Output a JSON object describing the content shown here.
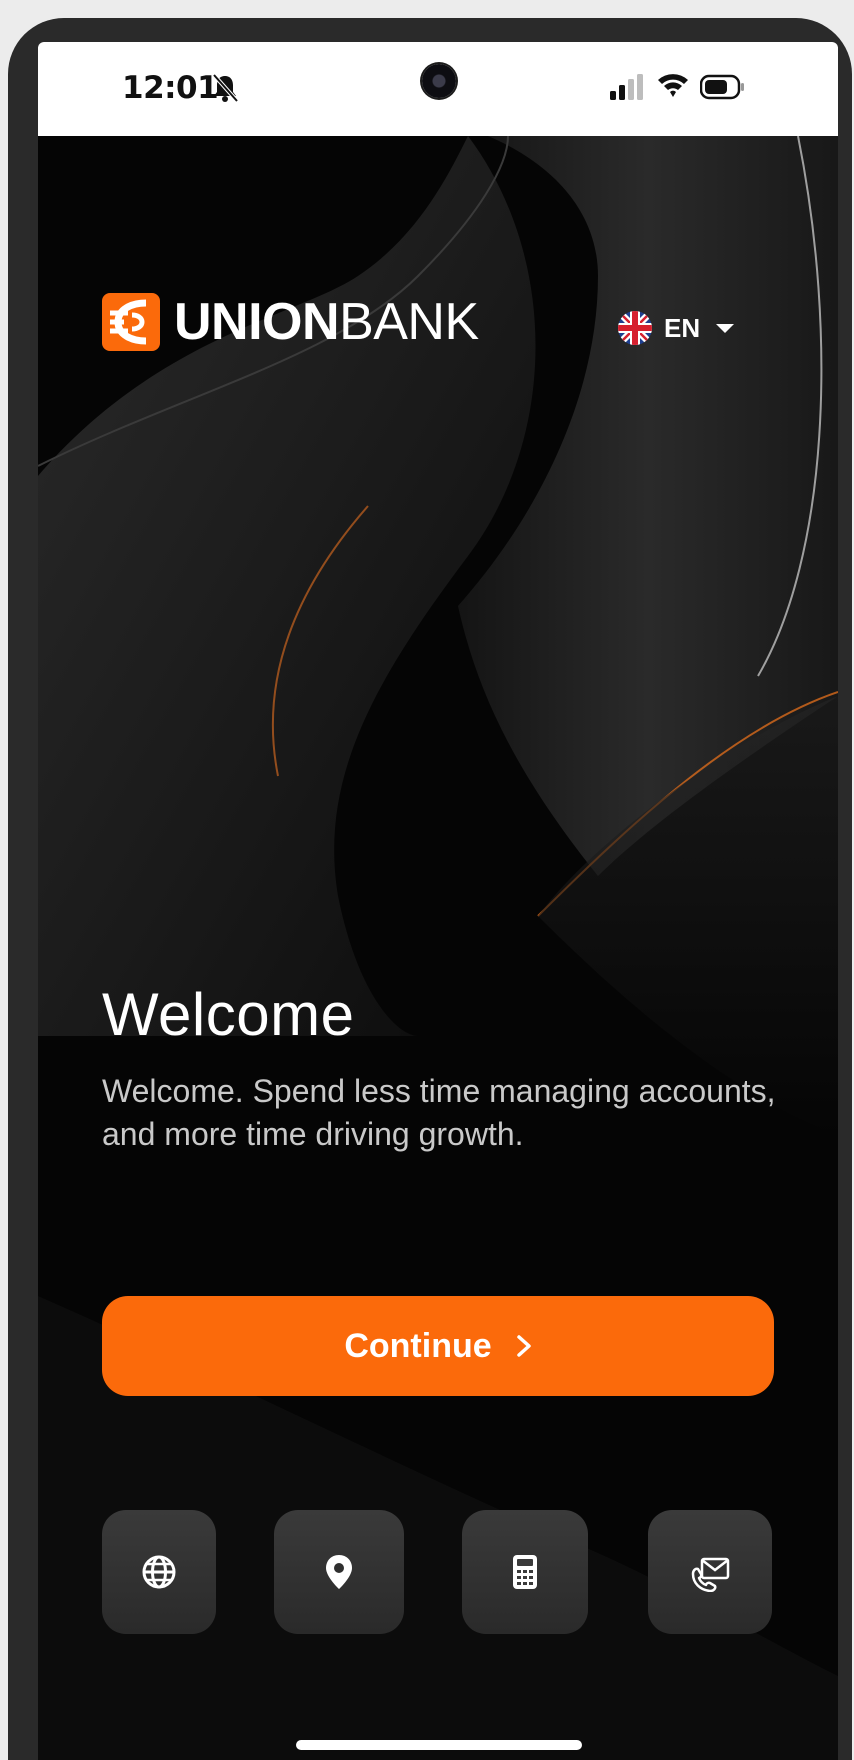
{
  "status_bar": {
    "time": "12:01",
    "icons": [
      "bell-off-icon",
      "camera-icon",
      "signal-icon",
      "wifi-icon",
      "battery-icon"
    ]
  },
  "header": {
    "logo_bold": "UNION",
    "logo_light": "BANK",
    "language": {
      "flag_icon": "uk-flag-icon",
      "label": "EN",
      "dropdown_icon": "caret-down-icon"
    }
  },
  "welcome": {
    "title": "Welcome",
    "description": "Welcome. Spend less time managing accounts, and more time driving growth."
  },
  "continue_button": {
    "label": "Continue",
    "icon": "chevron-right-icon"
  },
  "quick_actions": [
    {
      "icon": "globe-icon"
    },
    {
      "icon": "location-pin-icon"
    },
    {
      "icon": "calculator-icon"
    },
    {
      "icon": "contact-mail-icon"
    }
  ],
  "colors": {
    "accent": "#fb6a0b",
    "background": "#000000",
    "text_primary": "#ffffff",
    "text_secondary": "#c9c9c9",
    "button_dark": "#2f2f2f"
  }
}
